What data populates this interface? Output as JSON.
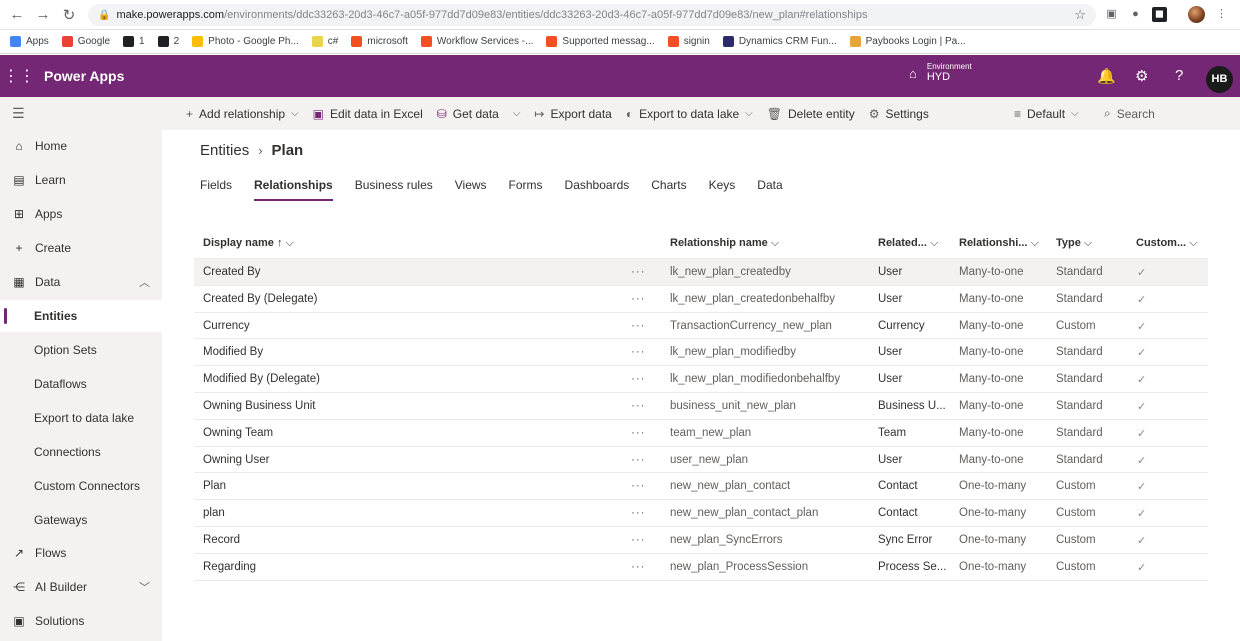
{
  "browser": {
    "url_host": "make.powerapps.com",
    "url_rest": "/environments/ddc33263-20d3-46c7-a05f-977dd7d09e83/entities/ddc33263-20d3-46c7-a05f-977dd7d09e83/new_plan#relationships",
    "bookmarks": [
      {
        "label": "Apps",
        "color": "#4285f4"
      },
      {
        "label": "Google",
        "color": "#ea4335"
      },
      {
        "label": "1",
        "color": "#202124"
      },
      {
        "label": "2",
        "color": "#202124"
      },
      {
        "label": "Photo - Google Ph...",
        "color": "#fbbc04"
      },
      {
        "label": "c#",
        "color": "#e8d44d"
      },
      {
        "label": "microsoft",
        "color": "#f25022"
      },
      {
        "label": "Workflow Services -...",
        "color": "#f25022"
      },
      {
        "label": "Supported messag...",
        "color": "#f25022"
      },
      {
        "label": "signin",
        "color": "#f25022"
      },
      {
        "label": "Dynamics CRM Fun...",
        "color": "#2b2b6b"
      },
      {
        "label": "Paybooks Login | Pa...",
        "color": "#e8a33d"
      }
    ]
  },
  "header": {
    "app_name": "Power Apps",
    "env_label": "Environment",
    "env_name": "HYD",
    "user_initials": "HB",
    "brand_color": "#742774"
  },
  "sidebar": {
    "items": [
      {
        "label": "Home",
        "icon": "home-icon"
      },
      {
        "label": "Learn",
        "icon": "book-icon"
      },
      {
        "label": "Apps",
        "icon": "apps-icon"
      },
      {
        "label": "Create",
        "icon": "plus-icon"
      },
      {
        "label": "Data",
        "icon": "table-icon"
      },
      {
        "label": "Entities"
      },
      {
        "label": "Option Sets"
      },
      {
        "label": "Dataflows"
      },
      {
        "label": "Export to data lake"
      },
      {
        "label": "Connections"
      },
      {
        "label": "Custom Connectors"
      },
      {
        "label": "Gateways"
      },
      {
        "label": "Flows",
        "icon": "flow-icon"
      },
      {
        "label": "AI Builder",
        "icon": "ai-icon"
      },
      {
        "label": "Solutions",
        "icon": "solutions-icon"
      }
    ]
  },
  "commands": {
    "add_relationship": "Add relationship",
    "edit_excel": "Edit data in Excel",
    "get_data": "Get data",
    "export_data": "Export data",
    "export_lake": "Export to data lake",
    "delete_entity": "Delete entity",
    "settings": "Settings",
    "view": "Default",
    "search": "Search"
  },
  "breadcrumb": {
    "parent": "Entities",
    "current": "Plan"
  },
  "tabs": [
    "Fields",
    "Relationships",
    "Business rules",
    "Views",
    "Forms",
    "Dashboards",
    "Charts",
    "Keys",
    "Data"
  ],
  "grid": {
    "headers": {
      "display_name": "Display name",
      "relationship_name": "Relationship name",
      "related": "Related...",
      "relationship": "Relationshi...",
      "type": "Type",
      "customizable": "Custom..."
    },
    "rows": [
      {
        "display": "Created By",
        "name": "lk_new_plan_createdby",
        "related": "User",
        "rel": "Many-to-one",
        "type": "Standard"
      },
      {
        "display": "Created By (Delegate)",
        "name": "lk_new_plan_createdonbehalfby",
        "related": "User",
        "rel": "Many-to-one",
        "type": "Standard"
      },
      {
        "display": "Currency",
        "name": "TransactionCurrency_new_plan",
        "related": "Currency",
        "rel": "Many-to-one",
        "type": "Custom"
      },
      {
        "display": "Modified By",
        "name": "lk_new_plan_modifiedby",
        "related": "User",
        "rel": "Many-to-one",
        "type": "Standard"
      },
      {
        "display": "Modified By (Delegate)",
        "name": "lk_new_plan_modifiedonbehalfby",
        "related": "User",
        "rel": "Many-to-one",
        "type": "Standard"
      },
      {
        "display": "Owning Business Unit",
        "name": "business_unit_new_plan",
        "related": "Business U...",
        "rel": "Many-to-one",
        "type": "Standard"
      },
      {
        "display": "Owning Team",
        "name": "team_new_plan",
        "related": "Team",
        "rel": "Many-to-one",
        "type": "Standard"
      },
      {
        "display": "Owning User",
        "name": "user_new_plan",
        "related": "User",
        "rel": "Many-to-one",
        "type": "Standard"
      },
      {
        "display": "Plan",
        "name": "new_new_plan_contact",
        "related": "Contact",
        "rel": "One-to-many",
        "type": "Custom"
      },
      {
        "display": "plan",
        "name": "new_new_plan_contact_plan",
        "related": "Contact",
        "rel": "One-to-many",
        "type": "Custom"
      },
      {
        "display": "Record",
        "name": "new_plan_SyncErrors",
        "related": "Sync Error",
        "rel": "One-to-many",
        "type": "Custom"
      },
      {
        "display": "Regarding",
        "name": "new_plan_ProcessSession",
        "related": "Process Se...",
        "rel": "One-to-many",
        "type": "Custom"
      }
    ]
  }
}
